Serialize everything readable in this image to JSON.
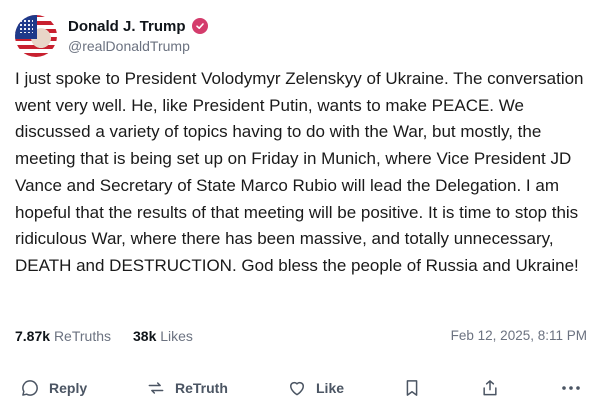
{
  "author": {
    "display_name": "Donald J. Trump",
    "handle": "@realDonaldTrump",
    "verified": true
  },
  "post": {
    "text": "I just spoke to President Volodymyr Zelenskyy of Ukraine. The conversation went very well. He, like President Putin, wants to make PEACE. We discussed a variety of topics having to do with the War, but mostly, the meeting that is being set up on Friday in Munich, where Vice President JD Vance and Secretary of State Marco Rubio will lead the Delegation. I am hopeful that the results of that meeting will be positive. It is time to stop this ridiculous War, where there has been massive, and totally unnecessary, DEATH and DESTRUCTION. God bless the people of Russia and Ukraine!",
    "retruths_count": "7.87k",
    "retruths_label": "ReTruths",
    "likes_count": "38k",
    "likes_label": "Likes",
    "timestamp": "Feb 12, 2025, 8:11 PM"
  },
  "actions": {
    "reply_label": "Reply",
    "retruth_label": "ReTruth",
    "like_label": "Like"
  },
  "icons": {
    "verified": "verified-badge-icon",
    "reply": "speech-bubble-icon",
    "retruth": "retruth-arrows-icon",
    "like": "heart-icon",
    "bookmark": "bookmark-icon",
    "share": "share-icon",
    "more": "more-dots-icon"
  },
  "colors": {
    "verified_badge": "#d43c6c",
    "text_primary": "#0f1419",
    "text_secondary": "#6b7280"
  }
}
